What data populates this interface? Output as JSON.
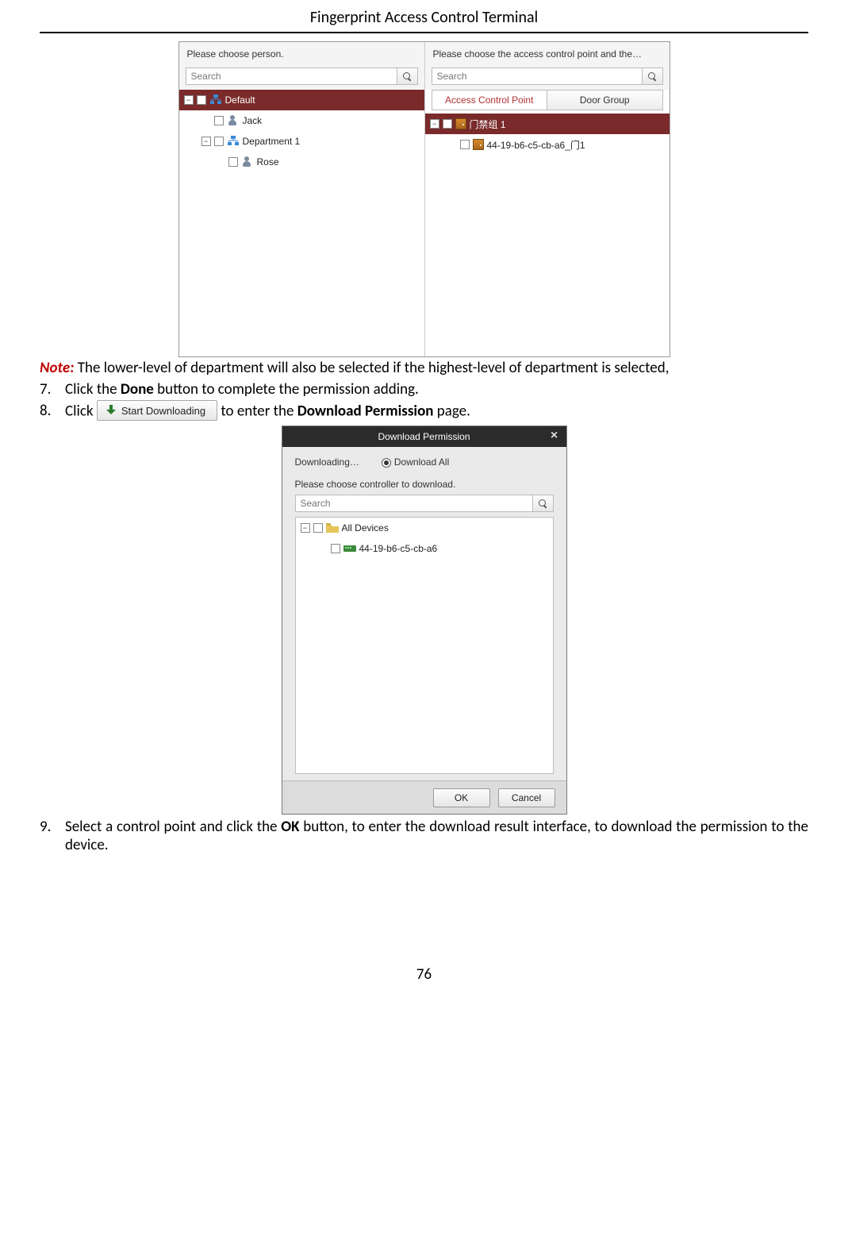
{
  "doc": {
    "title": "Fingerprint Access Control Terminal",
    "page_number": "76"
  },
  "note": {
    "prefix": "Note:",
    "text": " The lower-level of department will also be selected if the highest-level of department is selected,"
  },
  "steps": {
    "s7": {
      "num": "7.",
      "text_a": "Click the ",
      "bold": "Done",
      "text_b": " button to complete the permission adding."
    },
    "s8": {
      "num": "8.",
      "text_a": "Click ",
      "btn": "Start Downloading",
      "text_b": " to enter the ",
      "bold": "Download Permission",
      "text_c": " page."
    },
    "s9": {
      "num": "9.",
      "text_a": "Select a control point and click the ",
      "bold": "OK",
      "text_b": " button, to enter the download result interface, to download the permission to the device."
    }
  },
  "shot1": {
    "left": {
      "header": "Please choose person.",
      "search_placeholder": "Search",
      "rows": {
        "r0": "Default",
        "r1": "Jack",
        "r2": "Department 1",
        "r3": "Rose"
      }
    },
    "right": {
      "header": "Please choose the access control point and the…",
      "search_placeholder": "Search",
      "tabs": {
        "t0": "Access Control Point",
        "t1": "Door Group"
      },
      "rows": {
        "r0": "门禁组 1",
        "r1": "44-19-b6-c5-cb-a6_门1"
      }
    }
  },
  "shot2": {
    "title": "Download Permission",
    "top": {
      "downloading": "Downloading…",
      "radio": "Download All"
    },
    "sub": "Please choose controller to download.",
    "search_placeholder": "Search",
    "rows": {
      "r0": "All Devices",
      "r1": "44-19-b6-c5-cb-a6"
    },
    "buttons": {
      "ok": "OK",
      "cancel": "Cancel"
    }
  }
}
